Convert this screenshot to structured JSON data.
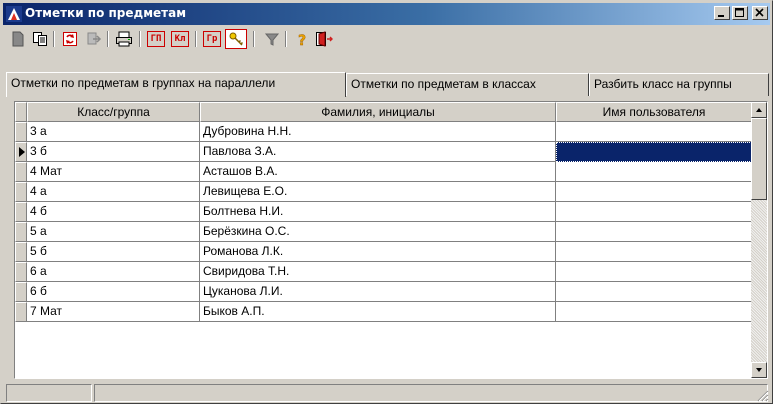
{
  "window": {
    "title": "Отметки по предметам",
    "buttons": {
      "minimize": "_",
      "maximize": "□",
      "close": "×"
    }
  },
  "toolbar": {
    "icons": [
      "document-icon",
      "copy-icon",
      "refresh-icon",
      "export-icon",
      "print-icon",
      "gp-icon",
      "kl-icon",
      "gr-icon",
      "key-icon",
      "filter-icon",
      "help-icon",
      "exit-icon"
    ],
    "gp_label": "ГП",
    "kl_label": "Кл",
    "gr_label": "Гр"
  },
  "tabs": [
    {
      "label": "Отметки по предметам в группах на параллели"
    },
    {
      "label": "Отметки по предметам в классах"
    },
    {
      "label": "Разбить класс на группы"
    }
  ],
  "grid": {
    "columns": [
      "Класс/группа",
      "Фамилия, инициалы",
      "Имя пользователя"
    ],
    "selected_row": 1,
    "rows": [
      {
        "class": "3 а",
        "name": "Дубровина Н.Н.",
        "user": ""
      },
      {
        "class": "3 б",
        "name": "Павлова З.А.",
        "user": ""
      },
      {
        "class": "4 Мат",
        "name": "Асташов В.А.",
        "user": ""
      },
      {
        "class": "4 а",
        "name": "Левищева Е.О.",
        "user": ""
      },
      {
        "class": "4 б",
        "name": "Болтнева Н.И.",
        "user": ""
      },
      {
        "class": "5 а",
        "name": "Берёзкина О.С.",
        "user": ""
      },
      {
        "class": "5 б",
        "name": "Романова Л.К.",
        "user": ""
      },
      {
        "class": "6 а",
        "name": "Свиридова Т.Н.",
        "user": ""
      },
      {
        "class": "6 б",
        "name": "Цуканова Л.И.",
        "user": ""
      },
      {
        "class": "7 Мат",
        "name": "Быков А.П.",
        "user": ""
      }
    ]
  },
  "colors": {
    "title_gradient_start": "#0a246a",
    "title_gradient_end": "#a6caf0",
    "selection": "#0a246a",
    "face": "#d4d0c8",
    "red_button": "#cc0000"
  }
}
